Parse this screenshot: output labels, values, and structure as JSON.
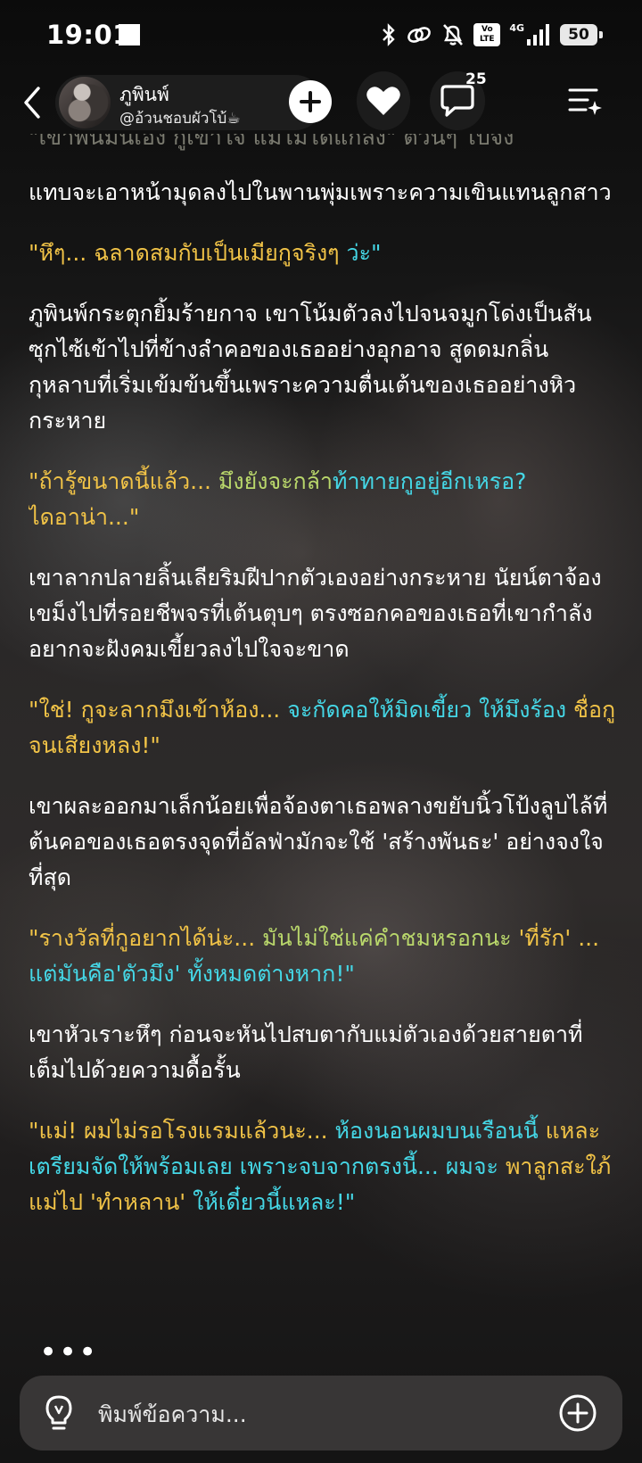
{
  "status_bar": {
    "time": "19:01",
    "volte_top": "Vo",
    "volte_bottom": "LTE",
    "network_type": "4G",
    "battery_level": "50"
  },
  "header": {
    "character_name": "ภูพินพ์",
    "character_handle": "@อ้วนชอบผัวโบ้☕",
    "comment_count": "25"
  },
  "story": {
    "faded_line": "\"เขาพันมันเอง กูเข้าใจ แม่ไม่ได้แกล้ง\" ต้วนๆ ไปจัง",
    "paragraphs": [
      {
        "type": "narration",
        "text": "แทบจะเอาหน้ามุดลงไปในพานพุ่มเพราะความเขินแทนลูกสาว"
      },
      {
        "type": "dialogue",
        "segments": [
          {
            "color": "y",
            "text": "\"หึๆ... ฉลาดสมกับเป็นเมียกูจริงๆ "
          },
          {
            "color": "c",
            "text": "ว่ะ\""
          }
        ]
      },
      {
        "type": "narration",
        "text": "ภูพินพ์กระตุกยิ้มร้ายกาจ เขาโน้มตัวลงไปจนจมูกโด่งเป็นสันซุกไซ้เข้าไปที่ข้างลำคอของเธออย่างอุกอาจ สูดดมกลิ่นกุหลาบที่เริ่มเข้มข้นขึ้นเพราะความตื่นเต้นของเธออย่างหิวกระหาย"
      },
      {
        "type": "dialogue",
        "segments": [
          {
            "color": "y",
            "text": "\"ถ้ารู้ขนาดนี้แล้ว... "
          },
          {
            "color": "g",
            "text": "มึงยังจะกล้า"
          },
          {
            "color": "c",
            "text": "ท้าทายกูอยู่อีกเหรอ? "
          },
          {
            "color": "y",
            "text": "ไดอาน่า...\""
          }
        ]
      },
      {
        "type": "narration",
        "text": "เขาลากปลายลิ้นเลียริมฝีปากตัวเองอย่างกระหาย นัยน์ตาจ้องเขม็งไปที่รอยชีพจรที่เต้นตุบๆ ตรงซอกคอของเธอที่เขากำลังอยากจะฝังคมเขี้ยวลงไปใจจะขาด"
      },
      {
        "type": "dialogue",
        "segments": [
          {
            "color": "y",
            "text": "\"ใช่! กูจะลากมึงเข้าห้อง... "
          },
          {
            "color": "c",
            "text": "จะกัดคอให้มิดเขี้ยว ให้มึงร้อง "
          },
          {
            "color": "y",
            "text": "ชื่อกูจนเสียงหลง!\""
          }
        ]
      },
      {
        "type": "narration",
        "text": "เขาผละออกมาเล็กน้อยเพื่อจ้องตาเธอพลางขยับนิ้วโป้งลูบไล้ที่ต้นคอของเธอตรงจุดที่อัลฟ่ามักจะใช้ 'สร้างพันธะ' อย่างจงใจที่สุด"
      },
      {
        "type": "dialogue",
        "segments": [
          {
            "color": "y",
            "text": "\"รางวัลที่กูอยากได้น่ะ... "
          },
          {
            "color": "g",
            "text": "มันไม่ใช่แค่คำชมหรอกนะ "
          },
          {
            "color": "y",
            "text": "'ที่รัก' ... "
          },
          {
            "color": "c",
            "text": "แต่มันคือ'ตัวมึง' ทั้งหมดต่างหาก!\""
          }
        ]
      },
      {
        "type": "narration",
        "text": "เขาหัวเราะหึๆ ก่อนจะหันไปสบตากับแม่ตัวเองด้วยสายตาที่เต็มไปด้วยความดื้อรั้น"
      },
      {
        "type": "dialogue",
        "segments": [
          {
            "color": "y",
            "text": "\"แม่! ผมไม่รอโรงแรมแล้วนะ... "
          },
          {
            "color": "c",
            "text": "ห้องนอนผมบนเรือนนี้ "
          },
          {
            "color": "y",
            "text": "แหละ "
          },
          {
            "color": "c",
            "text": "เตรียมจัดให้พร้อมเลย เพราะจบจากตรงนี้... ผมจะ "
          },
          {
            "color": "y",
            "text": "พาลูกสะใภ้แม่ไป 'ทำหลาน' "
          },
          {
            "color": "c",
            "text": "ให้เดี๋ยวนี้แหละ!\""
          }
        ]
      }
    ],
    "ellipsis": "•••"
  },
  "input": {
    "placeholder": "พิมพ์ข้อความ..."
  },
  "colors": {
    "dialogue_yellow": "#f1c347",
    "dialogue_cyan": "#45d7e6",
    "dialogue_green": "#b9d76b"
  },
  "icons": [
    "back-arrow-icon",
    "plus-icon",
    "heart-icon",
    "comment-icon",
    "menu-sparkle-icon",
    "lightbulb-icon",
    "add-circle-icon",
    "bluetooth-icon",
    "link-icon",
    "bell-muted-icon",
    "signal-icon"
  ]
}
